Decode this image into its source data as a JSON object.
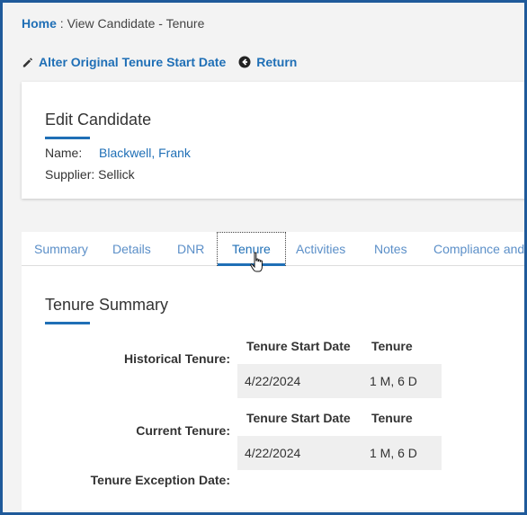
{
  "breadcrumb": {
    "home": "Home",
    "separator": " : ",
    "current": "View Candidate - Tenure"
  },
  "actions": {
    "alter_label": "Alter Original Tenure Start Date",
    "return_label": "Return"
  },
  "candidate_card": {
    "title": "Edit Candidate",
    "name_label": "Name:",
    "name_value": "Blackwell, Frank",
    "supplier_label": "Supplier:",
    "supplier_value": "Sellick"
  },
  "tabs": [
    {
      "label": "Summary"
    },
    {
      "label": "Details"
    },
    {
      "label": "DNR"
    },
    {
      "label": "Tenure",
      "active": true
    },
    {
      "label": "Activities"
    },
    {
      "label": "Notes"
    },
    {
      "label": "Compliance and"
    }
  ],
  "tenure_summary": {
    "title": "Tenure Summary",
    "historical": {
      "label": "Historical Tenure:",
      "columns": [
        "Tenure Start Date",
        "Tenure"
      ],
      "row": [
        "4/22/2024",
        "1 M, 6 D"
      ]
    },
    "current": {
      "label": "Current Tenure:",
      "columns": [
        "Tenure Start Date",
        "Tenure"
      ],
      "row": [
        "4/22/2024",
        "1 M, 6 D"
      ]
    },
    "exception_label": "Tenure Exception Date:"
  },
  "colors": {
    "accent": "#1f6fb6",
    "frame": "#1f5a9a",
    "tab_text": "#5b8fc8",
    "cell_bg": "#efefef"
  }
}
